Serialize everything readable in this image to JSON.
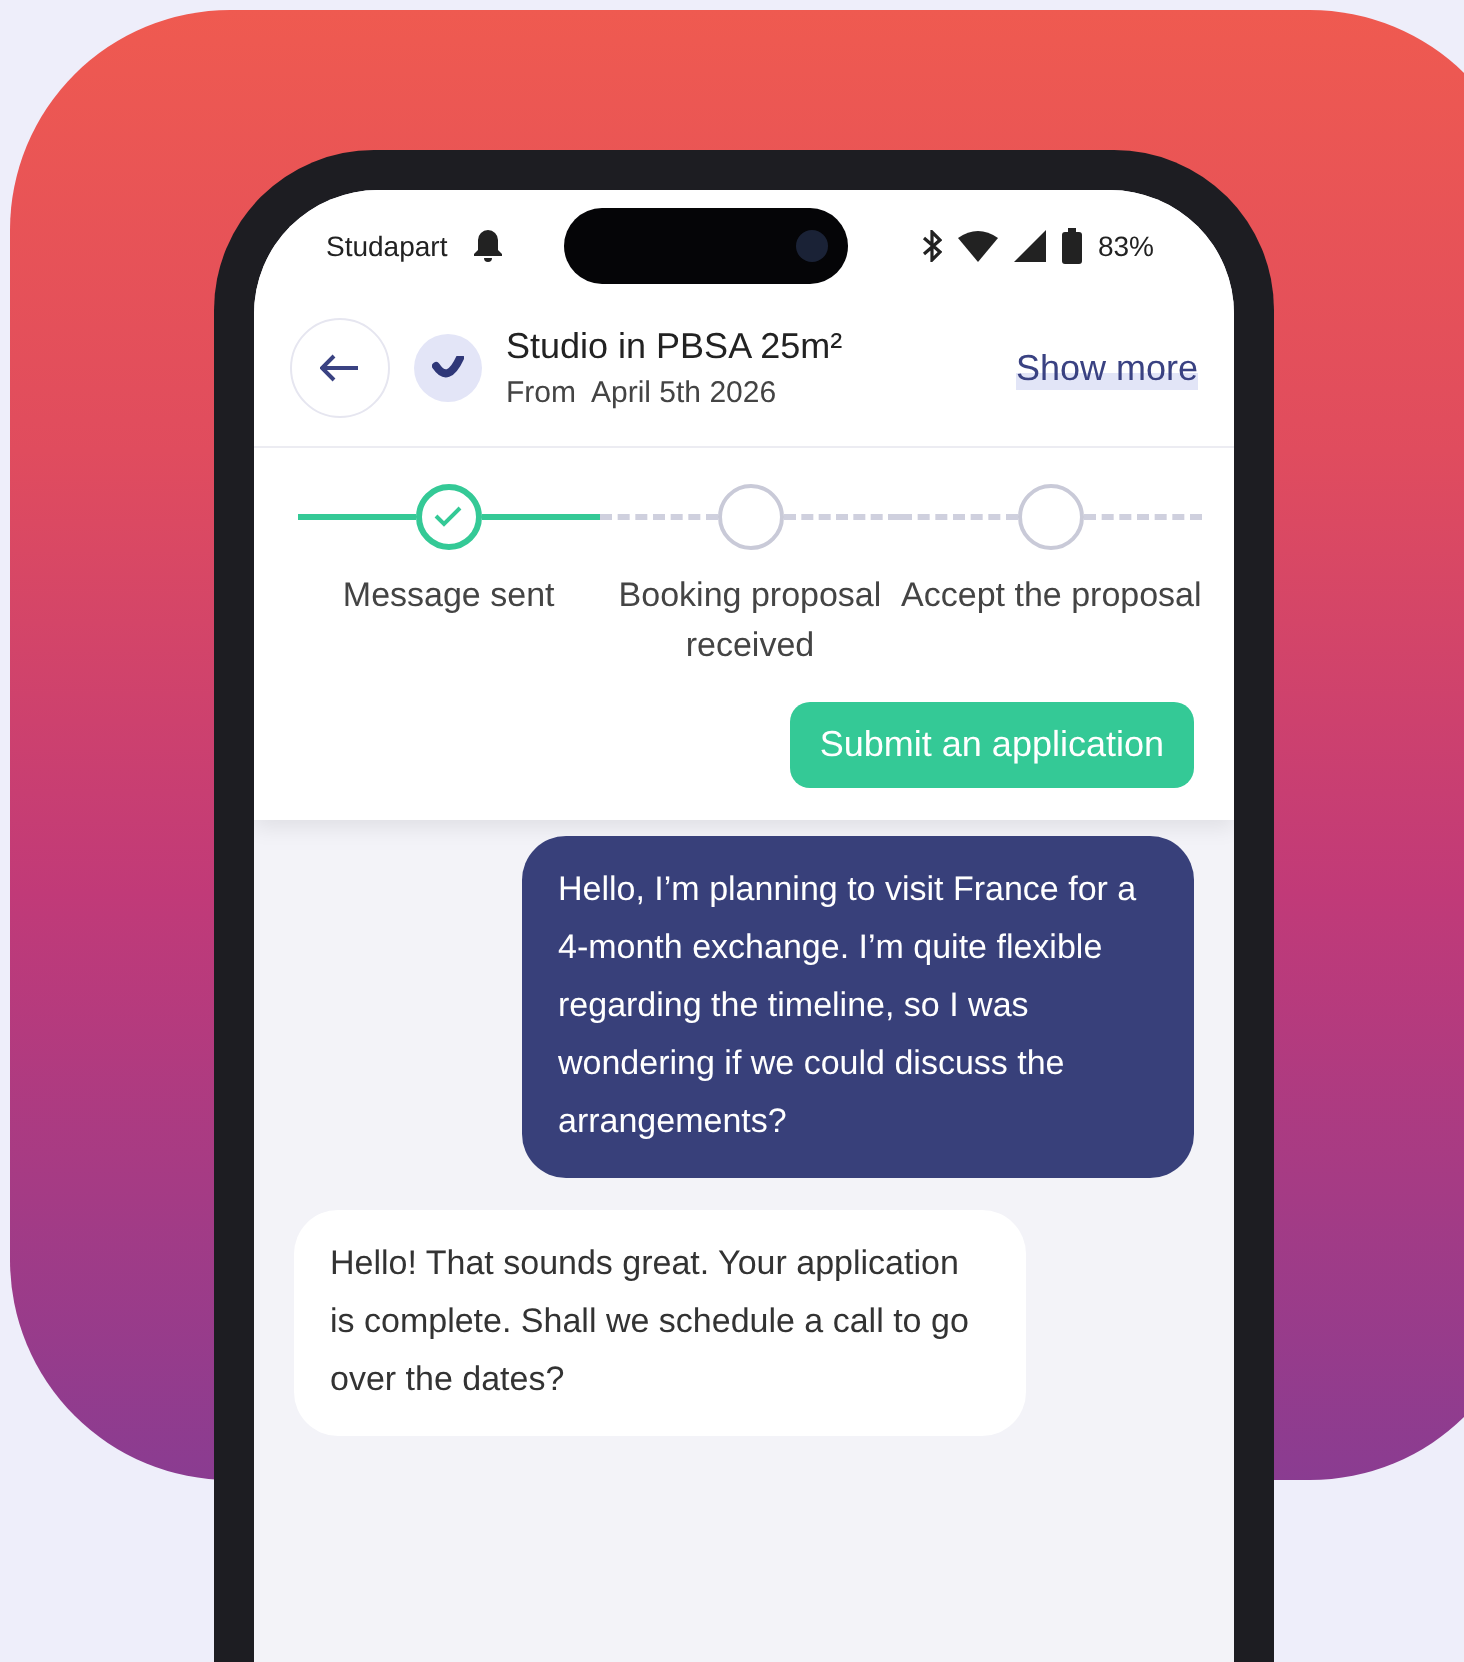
{
  "status_bar": {
    "carrier": "Studapart",
    "battery": "83%"
  },
  "header": {
    "title": "Studio in PBSA 25m²",
    "subtitle": "From  April 5th 2026",
    "action": "Show more"
  },
  "steps": [
    {
      "label": "Message sent",
      "done": true
    },
    {
      "label": "Booking proposal received",
      "done": false
    },
    {
      "label": "Accept the proposal",
      "done": false
    }
  ],
  "primary_button": "Submit an application",
  "messages": [
    {
      "kind": "sent",
      "text": "Hello, I’m planning to visit France for a 4-month exchange. I’m quite flexible regarding the timeline, so I was wondering if we could discuss the arrangements?"
    },
    {
      "kind": "received",
      "text": "Hello! That sounds great. Your application is complete. Shall we schedule a call to go over the dates?"
    }
  ]
}
